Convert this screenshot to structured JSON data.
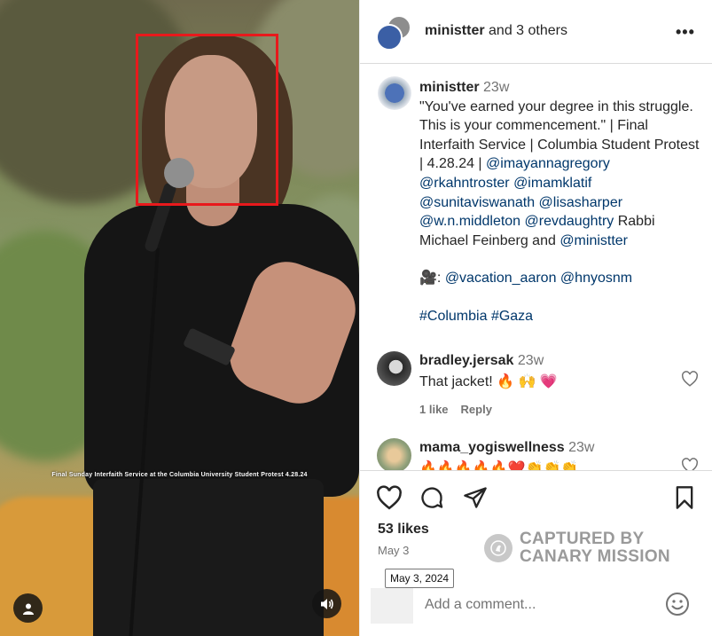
{
  "media": {
    "caption_overlay": "Final Sunday Interfaith Service at the Columbia University Student Protest 4.28.24"
  },
  "header": {
    "account": "ministter",
    "others": " and 3 others"
  },
  "post": {
    "username": "ministter",
    "age": "23w",
    "text": "\"You've earned your degree in this struggle. This is your commencement.\" | Final Interfaith Service | Columbia Student Protest | 4.28.24 | ",
    "mentions_a": [
      "@imayannagregory",
      "@rkahntroster",
      "@imamklatif",
      "@sunitaviswanath",
      "@lisasharper",
      "@w.n.middleton",
      "@revdaughtry"
    ],
    "text_after": " Rabbi Michael Feinberg and ",
    "mention_last": "@ministter",
    "credit_prefix": "🎥: ",
    "credit_mentions": [
      "@vacation_aaron",
      "@hnyosnm"
    ],
    "hashtags": [
      "#Columbia",
      "#Gaza"
    ]
  },
  "comments": [
    {
      "username": "bradley.jersak",
      "age": "23w",
      "text": "That jacket! 🔥 🙌 💗",
      "likes": "1 like",
      "reply": "Reply"
    },
    {
      "username": "mama_yogiswellness",
      "age": "23w",
      "text": "🔥🔥🔥🔥🔥❤️👏👏👏"
    }
  ],
  "footer": {
    "likes": "53 likes",
    "date": "May 3",
    "tooltip": "May 3, 2024",
    "add_comment_placeholder": "Add a comment..."
  },
  "watermark": {
    "line1": "CAPTURED BY",
    "line2": "CANARY MISSION"
  },
  "colors": {
    "link": "#00376b",
    "box": "#e8191c"
  }
}
